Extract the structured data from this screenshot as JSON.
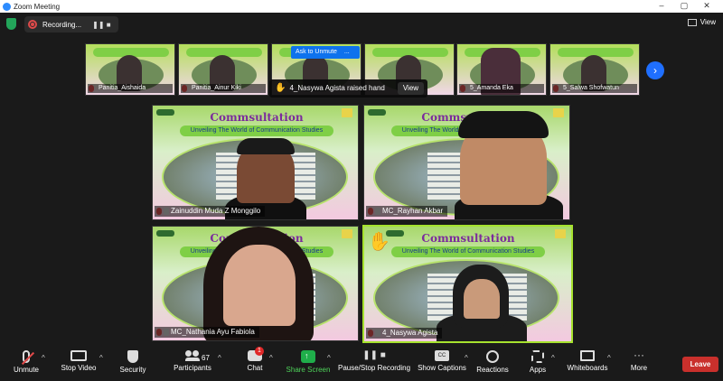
{
  "window": {
    "title": "Zoom Meeting"
  },
  "topbar": {
    "recording_label": "Recording...",
    "view_label": "View"
  },
  "strip": {
    "participants": [
      {
        "name": "Panitia_Aishaida"
      },
      {
        "name": "Panitia_Ainur Kiki"
      },
      {
        "name": ""
      },
      {
        "name": ""
      },
      {
        "name": "5_Amanda Eka"
      },
      {
        "name": "5_Salwa Shofwatun"
      }
    ],
    "ask_to_unmute": "Ask to Unmute",
    "ask_more": "...",
    "raised_hand_text": "4_Nasywa Agista raised hand",
    "raised_view_label": "View"
  },
  "tiles": [
    {
      "name": "Zainuddin Muda Z Monggilo",
      "title": "Commsultation",
      "subtitle": "Unveiling The World of Communication Studies"
    },
    {
      "name": "MC_Rayhan Akbar",
      "title": "Commsultation",
      "subtitle": "Unveiling The World of Communication Studies"
    },
    {
      "name": "MC_Nathania Ayu Fabiola",
      "title": "Commsultation",
      "subtitle": "Unveiling The World of Communication Studies"
    },
    {
      "name": "4_Nasywa Agista",
      "title": "Commsultation",
      "subtitle": "Unveiling The World of Communication Studies"
    }
  ],
  "toolbar": {
    "unmute": "Unmute",
    "stop_video": "Stop Video",
    "security": "Security",
    "participants": "Participants",
    "participants_count": "67",
    "chat": "Chat",
    "chat_badge": "1",
    "share_screen": "Share Screen",
    "pause_recording": "Pause/Stop Recording",
    "captions": "Show Captions",
    "reactions": "Reactions",
    "apps": "Apps",
    "whiteboards": "Whiteboards",
    "more": "More",
    "leave": "Leave"
  },
  "colors": {
    "accent": "#0e72ed",
    "share": "#1fae4a",
    "leave": "#c9302c",
    "active_border": "#a6e22e"
  }
}
